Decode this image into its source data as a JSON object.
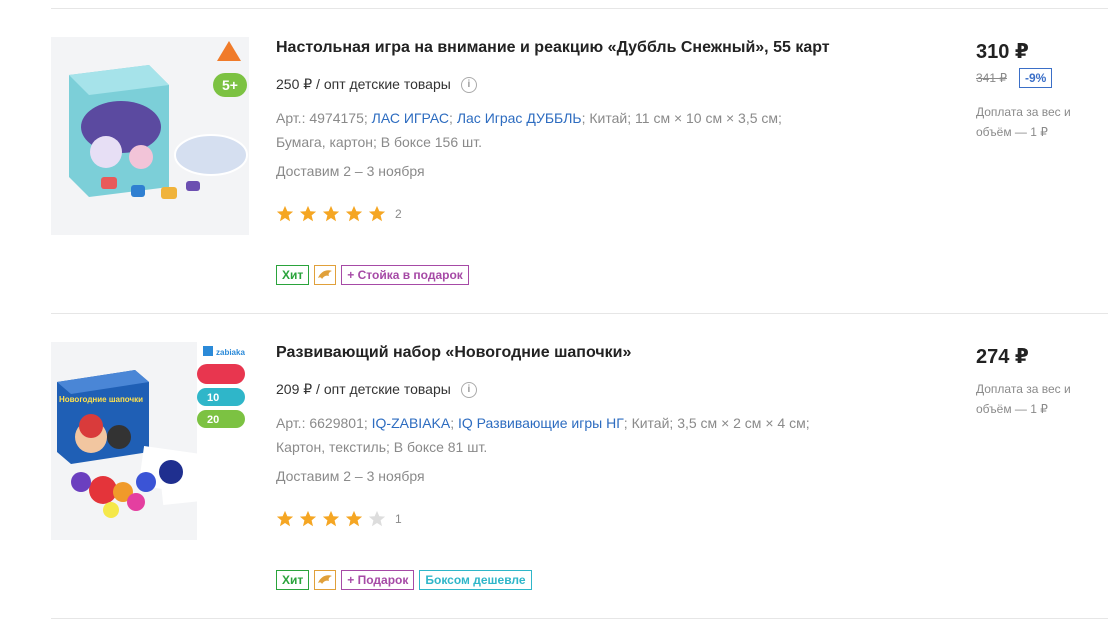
{
  "products": [
    {
      "title": "Настольная игра на внимание и реакцию «Дуббль Снежный», 55 карт",
      "wholesale": "250 ₽ / опт детские товары",
      "info_icon": "i",
      "art": "Арт.: 4974175;",
      "brand": "ЛАС ИГРАС",
      "sep1": ";",
      "series": "Лас Играс ДУББЛЬ",
      "sep2": ";",
      "country": "Китай;",
      "size": "11 см × 10 см × 3,5 см;",
      "material": "Бумага, картон;",
      "box": "В боксе 156 шт.",
      "delivery": "Доставим 2 – 3 ноября",
      "rating": 5,
      "reviews": "2",
      "tags": {
        "hit": "Хит",
        "promo": "+ Стойка в подарок"
      },
      "price": "310 ₽",
      "old_price": "341 ₽",
      "discount": "-9%",
      "surcharge": "Доплата за вес и объём — 1 ₽",
      "image_badge": "5+"
    },
    {
      "title": "Развивающий набор «Новогодние шапочки»",
      "wholesale": "209 ₽ / опт детские товары",
      "info_icon": "i",
      "art": "Арт.: 6629801;",
      "brand": "IQ-ZABIAKA",
      "sep1": ";",
      "series": "IQ Развивающие игры НГ",
      "sep2": ";",
      "country": "Китай;",
      "size": "3,5 см × 2 см × 4 см;",
      "material": "Картон, текстиль;",
      "box": "В боксе 81 шт.",
      "delivery": "Доставим 2 – 3 ноября",
      "rating": 4,
      "reviews": "1",
      "tags": {
        "hit": "Хит",
        "promo": "+ Подарок",
        "box": "Боксом дешевле"
      },
      "price": "274 ₽",
      "surcharge": "Доплата за вес и объём — 1 ₽",
      "image_label_1": "Новогодние шапочки",
      "image_brand": "zabiaka",
      "image_num_1": "10",
      "image_num_2": "20"
    }
  ],
  "colors": {
    "link": "#2d6cc0",
    "star_filled": "#f5a623",
    "star_empty": "#dddddd",
    "tag_hit": "#2aa33b",
    "tag_promo": "#a64aa6",
    "tag_box": "#2fb6c9",
    "discount": "#3b6fc7"
  },
  "icons": {
    "info": "info-icon",
    "star": "star-icon",
    "kit": "dolphin-icon"
  }
}
